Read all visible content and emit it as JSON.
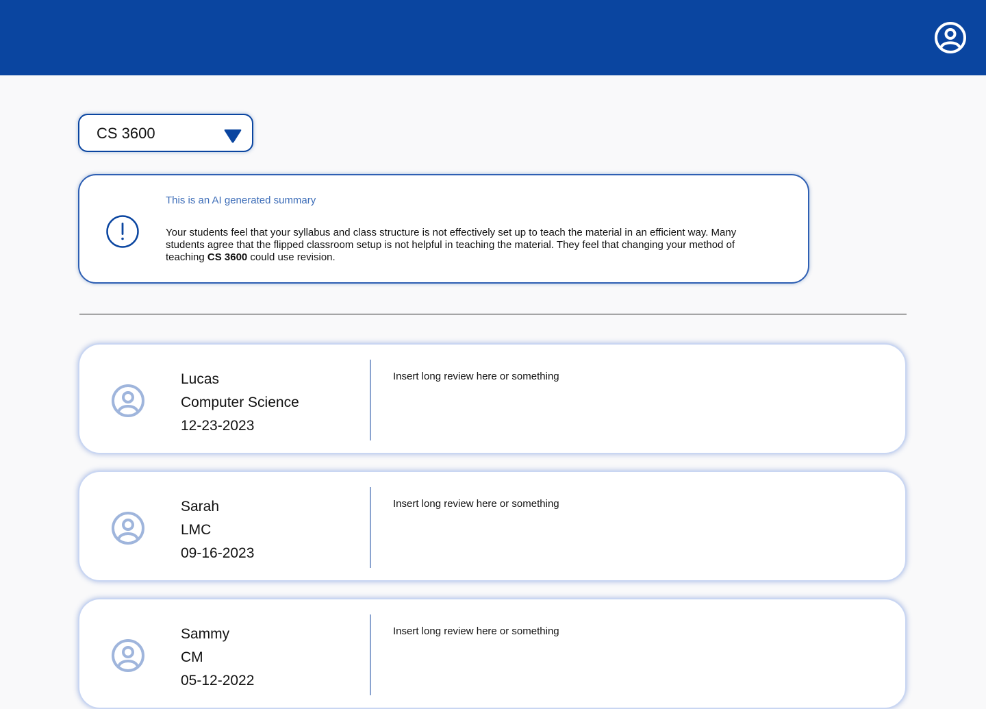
{
  "header": {
    "profile_icon": "user-circle-icon",
    "background": "#0a45a0"
  },
  "course_select": {
    "selected": "CS 3600",
    "caret_icon": "triangle-down-icon"
  },
  "summary": {
    "icon": "alert-circle-icon",
    "note": "This is an AI generated summary",
    "text_before": "Your students feel that your syllabus and class structure is not effectively set up to teach the material in an efficient way. Many students agree that the flipped classroom setup is not helpful in teaching the material. They feel that changing your method of teaching ",
    "text_bold": "CS 3600",
    "text_after": " could use revision."
  },
  "reviews": [
    {
      "name": "Lucas",
      "major": "Computer Science",
      "date": "12-23-2023",
      "text": "Insert long review here or something"
    },
    {
      "name": "Sarah",
      "major": "LMC",
      "date": "09-16-2023",
      "text": "Insert long review here or something"
    },
    {
      "name": "Sammy",
      "major": "CM",
      "date": "05-12-2022",
      "text": "Insert long review here or something"
    }
  ],
  "colors": {
    "primary": "#0a45a0",
    "accent_light": "#8aa3cf",
    "note_text": "#3d6db8"
  }
}
